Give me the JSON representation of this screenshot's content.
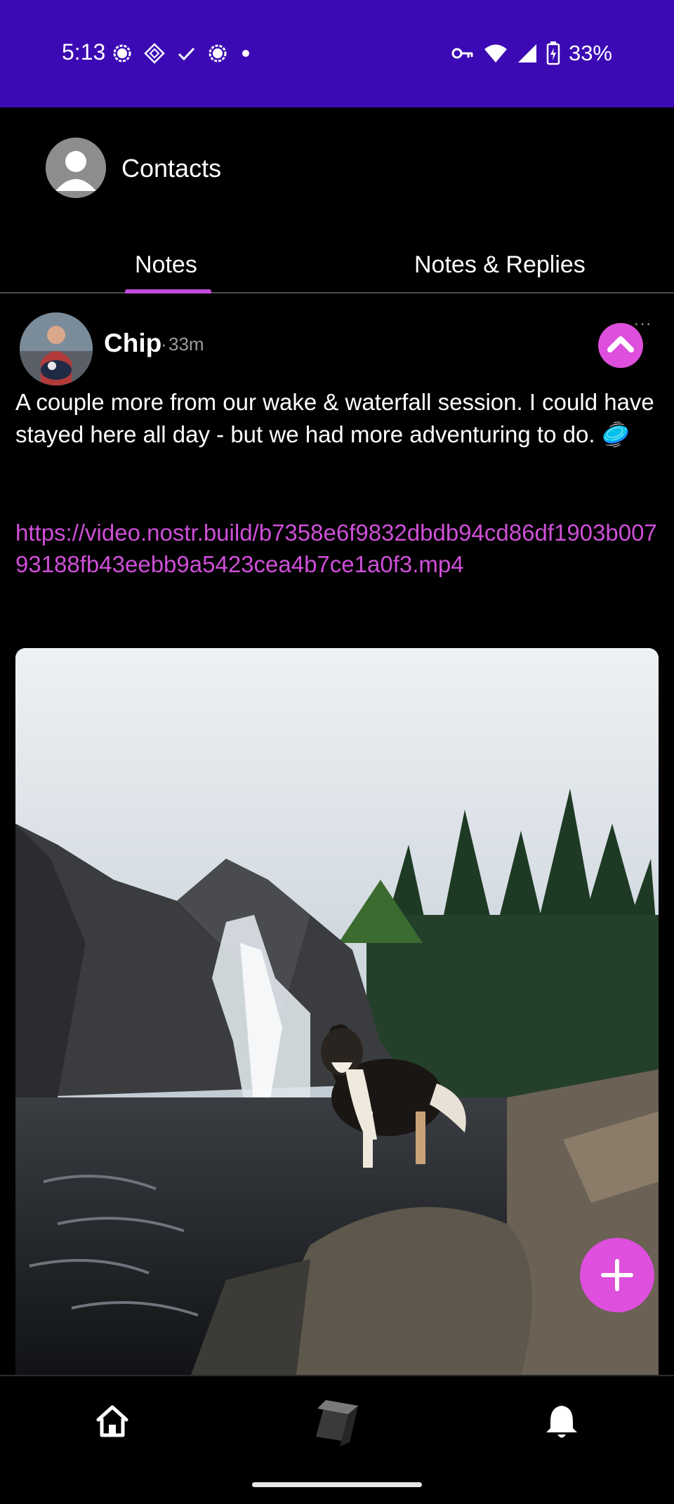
{
  "status_bar": {
    "time": "5:13",
    "battery": "33%",
    "background": "#3c0ab4",
    "left_icons": [
      "signal-app-icon",
      "diamond-icon",
      "check-icon",
      "signal-app-icon",
      "dot-icon"
    ],
    "right_icons": [
      "key-icon",
      "wifi-icon",
      "cell-signal-icon",
      "battery-charging-icon"
    ]
  },
  "header": {
    "title": "Contacts",
    "avatar": "default-avatar-icon"
  },
  "tabs": {
    "items": [
      {
        "label": "Notes",
        "selected": true
      },
      {
        "label": "Notes & Replies",
        "selected": false
      }
    ],
    "accent": "#c14ad8"
  },
  "post": {
    "author": "Chip",
    "separator": "·",
    "time": "33m",
    "more": "...",
    "text": "A couple more from our wake & waterfall session. I could have stayed here all day - but we had more adventuring to do. 🥏",
    "link": "https://video.nostr.build/b7358e6f9832dbdb94cd86df1903b00793188fb43eebb9a5423cea4b7ce1a0f3.mp4",
    "link_color": "#cf4fd8",
    "image": "waterfall-dog-photo"
  },
  "fab": {
    "icon": "plus-icon",
    "color": "#dd4fdc"
  },
  "bottom_nav": {
    "items": [
      "home-icon",
      "cube-icon",
      "bell-icon"
    ]
  }
}
